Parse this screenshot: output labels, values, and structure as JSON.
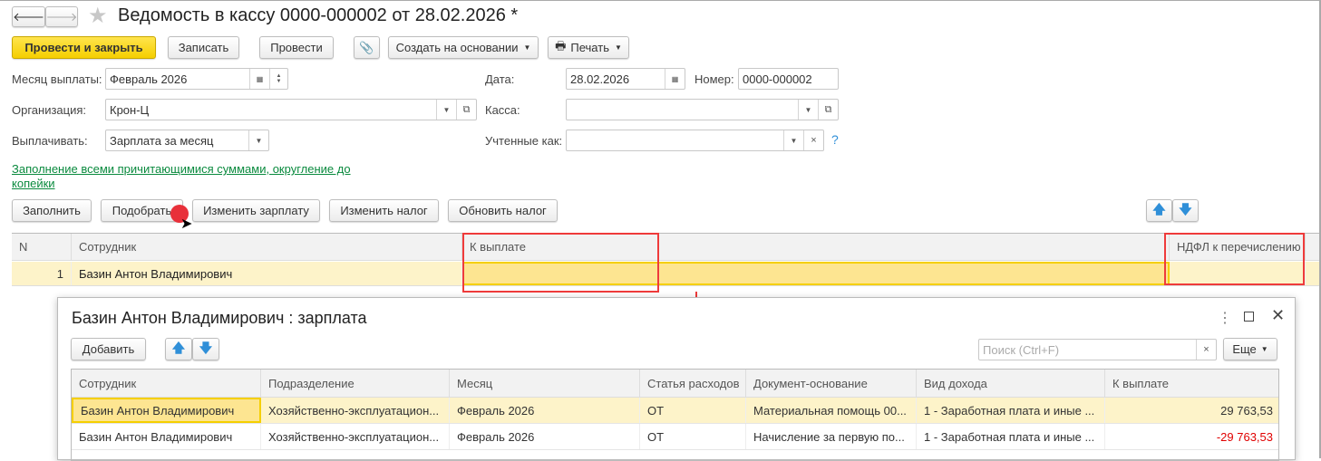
{
  "header": {
    "title": "Ведомость в кассу 0000-000002 от 28.02.2026 *"
  },
  "toolbar": {
    "post_close": "Провести и закрыть",
    "save": "Записать",
    "post": "Провести",
    "create_based": "Создать на основании",
    "print": "Печать"
  },
  "form": {
    "month_label": "Месяц выплаты:",
    "month_value": "Февраль 2026",
    "date_label": "Дата:",
    "date_value": "28.02.2026",
    "number_label": "Номер:",
    "number_value": "0000-000002",
    "org_label": "Организация:",
    "org_value": "Крон-Ц",
    "cash_label": "Касса:",
    "cash_value": "",
    "pay_label": "Выплачивать:",
    "pay_value": "Зарплата за месяц",
    "accounted_label": "Учтенные как:",
    "accounted_value": "",
    "help": "?",
    "fill_link": "Заполнение всеми причитающимися суммами, округление до копейки"
  },
  "table_toolbar": {
    "fill": "Заполнить",
    "pick": "Подобрать",
    "change_salary": "Изменить зарплату",
    "change_tax": "Изменить налог",
    "update_tax": "Обновить налог"
  },
  "table": {
    "columns": [
      "N",
      "Сотрудник",
      "К выплате",
      "НДФЛ к перечислению"
    ],
    "rows": [
      {
        "n": "1",
        "employee": "Базин Антон Владимирович",
        "pay": "",
        "ndfl": ""
      }
    ]
  },
  "dialog": {
    "title": "Базин Антон Владимирович : зарплата",
    "add": "Добавить",
    "search_placeholder": "Поиск (Ctrl+F)",
    "more": "Еще",
    "columns": [
      "Сотрудник",
      "Подразделение",
      "Месяц",
      "Статья расходов",
      "Документ-основание",
      "Вид дохода",
      "К выплате"
    ],
    "rows": [
      {
        "employee": "Базин Антон Владимирович",
        "dept": "Хозяйственно-эксплуатацион...",
        "month": "Февраль 2026",
        "expense": "ОТ",
        "doc": "Материальная помощь 00...",
        "income": "1 - Заработная плата и иные ...",
        "pay": "29 763,53"
      },
      {
        "employee": "Базин Антон Владимирович",
        "dept": "Хозяйственно-эксплуатацион...",
        "month": "Февраль 2026",
        "expense": "ОТ",
        "doc": "Начисление за первую по...",
        "income": "1 - Заработная плата и иные ...",
        "pay": "-29 763,53"
      }
    ]
  },
  "colors": {
    "accent": "#f5cf00",
    "link": "#0a8a3e",
    "negative": "#e00000",
    "highlight": "#ef3b3b"
  }
}
